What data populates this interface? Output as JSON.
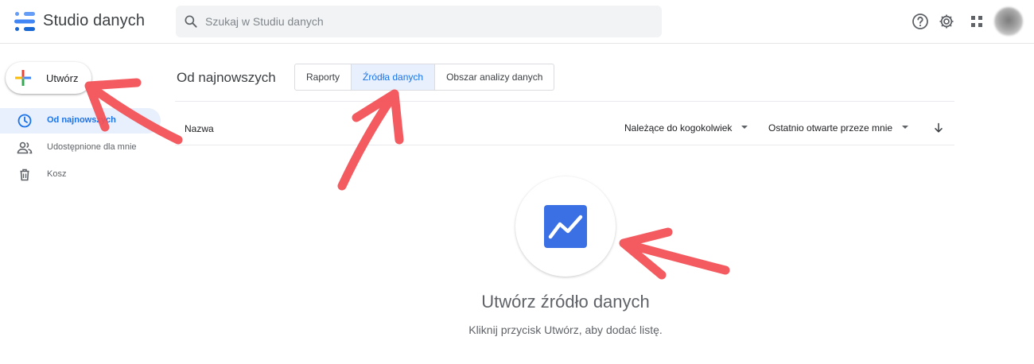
{
  "header": {
    "app_title": "Studio danych",
    "search_placeholder": "Szukaj w Studiu danych"
  },
  "sidebar": {
    "create_label": "Utwórz",
    "items": [
      {
        "label": "Od najnowszych",
        "icon": "clock-icon",
        "active": true
      },
      {
        "label": "Udostępnione dla mnie",
        "icon": "people-icon",
        "active": false
      },
      {
        "label": "Kosz",
        "icon": "trash-icon",
        "active": false
      }
    ]
  },
  "main": {
    "section_title": "Od najnowszych",
    "tabs": [
      {
        "label": "Raporty",
        "active": false
      },
      {
        "label": "Źródła danych",
        "active": true
      },
      {
        "label": "Obszar analizy danych",
        "active": false
      }
    ],
    "columns": {
      "name": "Nazwa",
      "owner_filter": "Należące do kogokolwiek",
      "opened_filter": "Ostatnio otwarte przeze mnie"
    },
    "empty_state": {
      "title": "Utwórz źródło danych",
      "subtitle": "Kliknij przycisk Utwórz, aby dodać listę.",
      "icon": "data-source-icon"
    }
  },
  "colors": {
    "accent": "#1a73e8",
    "active_bg": "#e8f0fe",
    "annotation_arrow": "#f25257",
    "data_source_icon": "#3b6fe4"
  }
}
